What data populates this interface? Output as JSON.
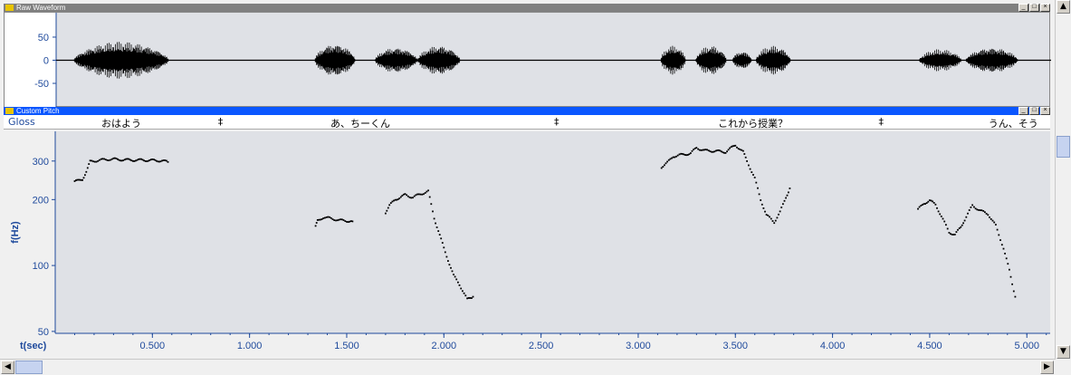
{
  "waveform_window": {
    "title": "Raw Waveform",
    "buttons": [
      "_",
      "□",
      "×"
    ]
  },
  "pitch_window": {
    "title": "Custom Pitch",
    "buttons": [
      "_",
      "□",
      "×"
    ]
  },
  "gloss": {
    "label": "Gloss",
    "items": [
      {
        "text": "おはよう",
        "t": 0.34
      },
      {
        "text": "あ、ちーくん",
        "t": 1.57
      },
      {
        "text": "これから授業？",
        "t": 3.59
      },
      {
        "text": "うん、そう",
        "t": 4.93
      }
    ],
    "separators": [
      {
        "text": "‡",
        "t": 0.85
      },
      {
        "text": "‡",
        "t": 2.58
      },
      {
        "text": "‡",
        "t": 4.25
      }
    ]
  },
  "colors": {
    "title_active": "#0a56ff",
    "title_inactive": "#808080",
    "plot_bg": "#dfe1e6",
    "axis_text": "#1f4a9c",
    "data": "#000000"
  },
  "chart_data": [
    {
      "type": "area",
      "title": "Raw Waveform",
      "y_ticks": [
        "50",
        "0",
        "-50"
      ],
      "ylim": [
        -95,
        95
      ],
      "xlim": [
        0,
        5.12
      ],
      "bursts": [
        {
          "t0": 0.09,
          "t1": 0.58,
          "amp": 50
        },
        {
          "t0": 1.33,
          "t1": 1.54,
          "amp": 45
        },
        {
          "t0": 1.64,
          "t1": 1.86,
          "amp": 35
        },
        {
          "t0": 1.86,
          "t1": 2.08,
          "amp": 40
        },
        {
          "t0": 3.11,
          "t1": 3.24,
          "amp": 40
        },
        {
          "t0": 3.29,
          "t1": 3.45,
          "amp": 40
        },
        {
          "t0": 3.48,
          "t1": 3.58,
          "amp": 25
        },
        {
          "t0": 3.6,
          "t1": 3.78,
          "amp": 40
        },
        {
          "t0": 4.44,
          "t1": 4.66,
          "amp": 30
        },
        {
          "t0": 4.68,
          "t1": 4.95,
          "amp": 35
        }
      ]
    },
    {
      "type": "scatter",
      "title": "Custom Pitch",
      "ylabel": "f(Hz)",
      "xlabel": "t(sec)",
      "log_y": true,
      "ylim": [
        49,
        410
      ],
      "xlim": [
        0,
        5.12
      ],
      "y_ticks": [
        300,
        200,
        100,
        50
      ],
      "x_ticks": [
        "0.500",
        "1.000",
        "1.500",
        "2.000",
        "2.500",
        "3.000",
        "3.500",
        "4.000",
        "4.500",
        "5.000"
      ],
      "segments": [
        [
          [
            0.1,
            242
          ],
          [
            0.12,
            244
          ],
          [
            0.14,
            248
          ],
          [
            0.16,
            268
          ],
          [
            0.18,
            298
          ],
          [
            0.22,
            302
          ],
          [
            0.26,
            305
          ],
          [
            0.3,
            306
          ],
          [
            0.35,
            304
          ],
          [
            0.4,
            303
          ],
          [
            0.45,
            303
          ],
          [
            0.5,
            302
          ],
          [
            0.55,
            301
          ],
          [
            0.58,
            297
          ]
        ],
        [
          [
            1.34,
            150
          ],
          [
            1.35,
            160
          ],
          [
            1.38,
            166
          ],
          [
            1.42,
            164
          ],
          [
            1.46,
            161
          ],
          [
            1.5,
            160
          ],
          [
            1.53,
            159
          ]
        ],
        [
          [
            1.7,
            175
          ],
          [
            1.72,
            188
          ],
          [
            1.75,
            200
          ],
          [
            1.8,
            210
          ],
          [
            1.84,
            205
          ],
          [
            1.88,
            212
          ],
          [
            1.92,
            218
          ],
          [
            1.95,
            165
          ],
          [
            2.0,
            120
          ],
          [
            2.05,
            90
          ],
          [
            2.08,
            82
          ],
          [
            2.12,
            70
          ],
          [
            2.15,
            72
          ]
        ],
        [
          [
            3.12,
            282
          ],
          [
            3.15,
            295
          ],
          [
            3.18,
            315
          ],
          [
            3.22,
            320
          ],
          [
            3.27,
            325
          ],
          [
            3.3,
            345
          ],
          [
            3.34,
            335
          ],
          [
            3.4,
            333
          ],
          [
            3.45,
            330
          ],
          [
            3.5,
            355
          ],
          [
            3.54,
            330
          ],
          [
            3.56,
            300
          ],
          [
            3.6,
            250
          ],
          [
            3.63,
            200
          ],
          [
            3.66,
            170
          ],
          [
            3.7,
            158
          ],
          [
            3.73,
            175
          ],
          [
            3.76,
            205
          ],
          [
            3.78,
            225
          ]
        ],
        [
          [
            4.44,
            180
          ],
          [
            4.47,
            192
          ],
          [
            4.5,
            198
          ],
          [
            4.53,
            190
          ],
          [
            4.56,
            168
          ],
          [
            4.6,
            142
          ],
          [
            4.63,
            138
          ],
          [
            4.66,
            150
          ],
          [
            4.68,
            162
          ],
          [
            4.72,
            188
          ],
          [
            4.76,
            178
          ],
          [
            4.8,
            172
          ],
          [
            4.84,
            152
          ],
          [
            4.88,
            120
          ],
          [
            4.91,
            95
          ],
          [
            4.94,
            72
          ]
        ]
      ]
    }
  ]
}
